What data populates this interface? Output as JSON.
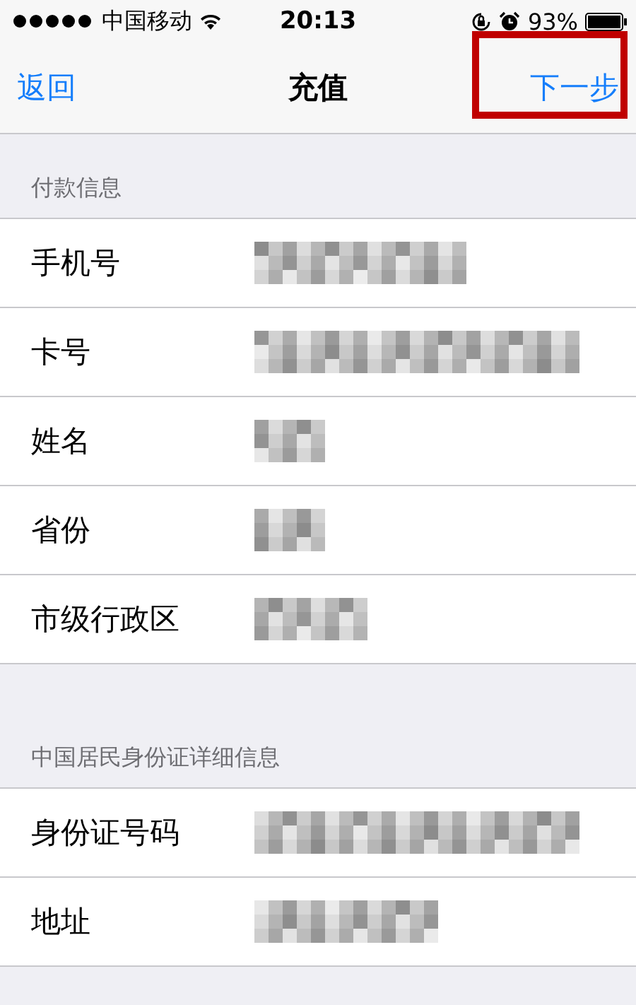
{
  "status_bar": {
    "carrier": "中国移动",
    "time": "20:13",
    "battery": "93%"
  },
  "nav": {
    "back": "返回",
    "title": "充值",
    "next": "下一步",
    "next_highlighted": true
  },
  "sections": [
    {
      "header": "付款信息",
      "rows": [
        {
          "label": "手机号",
          "redacted": true
        },
        {
          "label": "卡号",
          "redacted": true
        },
        {
          "label": "姓名",
          "redacted": true
        },
        {
          "label": "省份",
          "redacted": true
        },
        {
          "label": "市级行政区",
          "redacted": true
        }
      ]
    },
    {
      "header": "中国居民身份证详细信息",
      "rows": [
        {
          "label": "身份证号码",
          "redacted": true
        },
        {
          "label": "地址",
          "redacted": true
        }
      ]
    }
  ]
}
